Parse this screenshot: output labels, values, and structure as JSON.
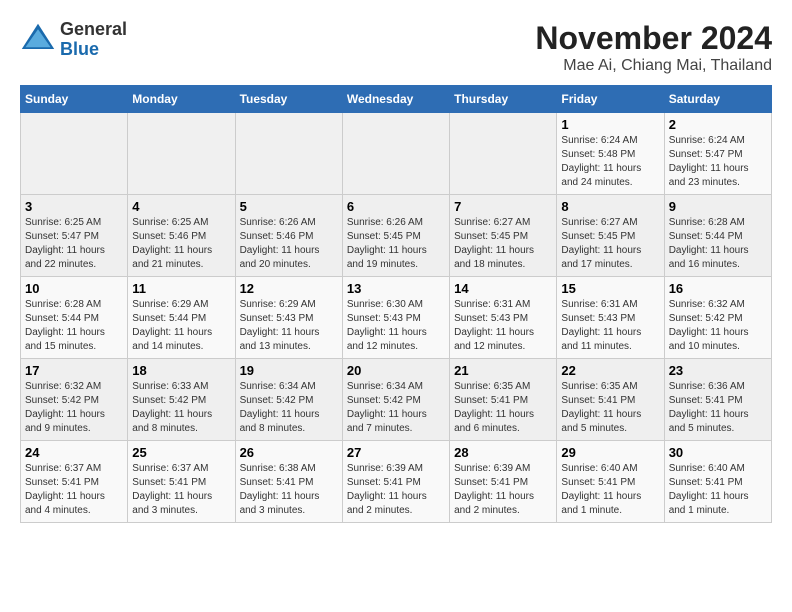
{
  "header": {
    "logo_general": "General",
    "logo_blue": "Blue",
    "month_title": "November 2024",
    "location": "Mae Ai, Chiang Mai, Thailand"
  },
  "days_of_week": [
    "Sunday",
    "Monday",
    "Tuesday",
    "Wednesday",
    "Thursday",
    "Friday",
    "Saturday"
  ],
  "weeks": [
    [
      {
        "day": "",
        "info": ""
      },
      {
        "day": "",
        "info": ""
      },
      {
        "day": "",
        "info": ""
      },
      {
        "day": "",
        "info": ""
      },
      {
        "day": "",
        "info": ""
      },
      {
        "day": "1",
        "info": "Sunrise: 6:24 AM\nSunset: 5:48 PM\nDaylight: 11 hours\nand 24 minutes."
      },
      {
        "day": "2",
        "info": "Sunrise: 6:24 AM\nSunset: 5:47 PM\nDaylight: 11 hours\nand 23 minutes."
      }
    ],
    [
      {
        "day": "3",
        "info": "Sunrise: 6:25 AM\nSunset: 5:47 PM\nDaylight: 11 hours\nand 22 minutes."
      },
      {
        "day": "4",
        "info": "Sunrise: 6:25 AM\nSunset: 5:46 PM\nDaylight: 11 hours\nand 21 minutes."
      },
      {
        "day": "5",
        "info": "Sunrise: 6:26 AM\nSunset: 5:46 PM\nDaylight: 11 hours\nand 20 minutes."
      },
      {
        "day": "6",
        "info": "Sunrise: 6:26 AM\nSunset: 5:45 PM\nDaylight: 11 hours\nand 19 minutes."
      },
      {
        "day": "7",
        "info": "Sunrise: 6:27 AM\nSunset: 5:45 PM\nDaylight: 11 hours\nand 18 minutes."
      },
      {
        "day": "8",
        "info": "Sunrise: 6:27 AM\nSunset: 5:45 PM\nDaylight: 11 hours\nand 17 minutes."
      },
      {
        "day": "9",
        "info": "Sunrise: 6:28 AM\nSunset: 5:44 PM\nDaylight: 11 hours\nand 16 minutes."
      }
    ],
    [
      {
        "day": "10",
        "info": "Sunrise: 6:28 AM\nSunset: 5:44 PM\nDaylight: 11 hours\nand 15 minutes."
      },
      {
        "day": "11",
        "info": "Sunrise: 6:29 AM\nSunset: 5:44 PM\nDaylight: 11 hours\nand 14 minutes."
      },
      {
        "day": "12",
        "info": "Sunrise: 6:29 AM\nSunset: 5:43 PM\nDaylight: 11 hours\nand 13 minutes."
      },
      {
        "day": "13",
        "info": "Sunrise: 6:30 AM\nSunset: 5:43 PM\nDaylight: 11 hours\nand 12 minutes."
      },
      {
        "day": "14",
        "info": "Sunrise: 6:31 AM\nSunset: 5:43 PM\nDaylight: 11 hours\nand 12 minutes."
      },
      {
        "day": "15",
        "info": "Sunrise: 6:31 AM\nSunset: 5:43 PM\nDaylight: 11 hours\nand 11 minutes."
      },
      {
        "day": "16",
        "info": "Sunrise: 6:32 AM\nSunset: 5:42 PM\nDaylight: 11 hours\nand 10 minutes."
      }
    ],
    [
      {
        "day": "17",
        "info": "Sunrise: 6:32 AM\nSunset: 5:42 PM\nDaylight: 11 hours\nand 9 minutes."
      },
      {
        "day": "18",
        "info": "Sunrise: 6:33 AM\nSunset: 5:42 PM\nDaylight: 11 hours\nand 8 minutes."
      },
      {
        "day": "19",
        "info": "Sunrise: 6:34 AM\nSunset: 5:42 PM\nDaylight: 11 hours\nand 8 minutes."
      },
      {
        "day": "20",
        "info": "Sunrise: 6:34 AM\nSunset: 5:42 PM\nDaylight: 11 hours\nand 7 minutes."
      },
      {
        "day": "21",
        "info": "Sunrise: 6:35 AM\nSunset: 5:41 PM\nDaylight: 11 hours\nand 6 minutes."
      },
      {
        "day": "22",
        "info": "Sunrise: 6:35 AM\nSunset: 5:41 PM\nDaylight: 11 hours\nand 5 minutes."
      },
      {
        "day": "23",
        "info": "Sunrise: 6:36 AM\nSunset: 5:41 PM\nDaylight: 11 hours\nand 5 minutes."
      }
    ],
    [
      {
        "day": "24",
        "info": "Sunrise: 6:37 AM\nSunset: 5:41 PM\nDaylight: 11 hours\nand 4 minutes."
      },
      {
        "day": "25",
        "info": "Sunrise: 6:37 AM\nSunset: 5:41 PM\nDaylight: 11 hours\nand 3 minutes."
      },
      {
        "day": "26",
        "info": "Sunrise: 6:38 AM\nSunset: 5:41 PM\nDaylight: 11 hours\nand 3 minutes."
      },
      {
        "day": "27",
        "info": "Sunrise: 6:39 AM\nSunset: 5:41 PM\nDaylight: 11 hours\nand 2 minutes."
      },
      {
        "day": "28",
        "info": "Sunrise: 6:39 AM\nSunset: 5:41 PM\nDaylight: 11 hours\nand 2 minutes."
      },
      {
        "day": "29",
        "info": "Sunrise: 6:40 AM\nSunset: 5:41 PM\nDaylight: 11 hours\nand 1 minute."
      },
      {
        "day": "30",
        "info": "Sunrise: 6:40 AM\nSunset: 5:41 PM\nDaylight: 11 hours\nand 1 minute."
      }
    ]
  ]
}
